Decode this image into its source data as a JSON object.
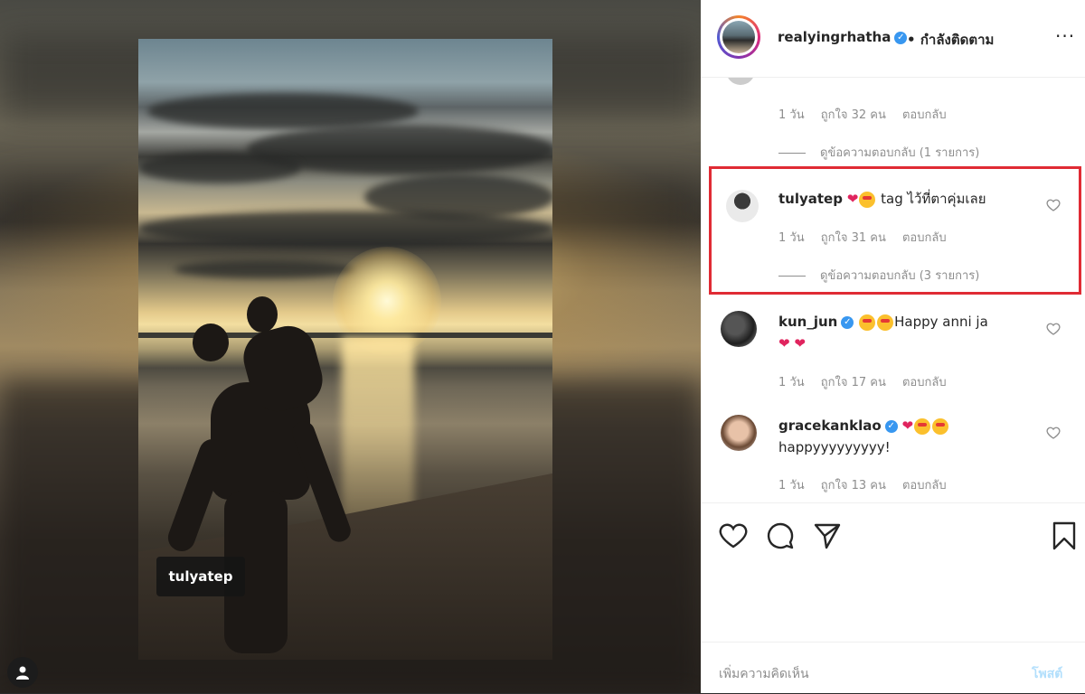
{
  "post": {
    "photo_tag": "tulyatep"
  },
  "header": {
    "username": "realyingrhatha",
    "separator": "•",
    "follow_status": "กำลังติดตาม",
    "more": "···"
  },
  "comments": {
    "top": {
      "partial_text": "",
      "time": "1 วัน",
      "likes": "ถูกใจ 32 คน",
      "reply": "ตอบกลับ",
      "view_replies": "ดูข้อความตอบกลับ (1 รายการ)"
    },
    "c1": {
      "username": "tulyatep",
      "text": "tag ไว้ที่ตาคุ่มเลย",
      "time": "1 วัน",
      "likes": "ถูกใจ 31 คน",
      "reply": "ตอบกลับ",
      "view_replies": "ดูข้อความตอบกลับ (3 รายการ)"
    },
    "c2": {
      "username": "kun_jun",
      "text": "Happy anni ja",
      "time": "1 วัน",
      "likes": "ถูกใจ 17 คน",
      "reply": "ตอบกลับ"
    },
    "c3": {
      "username": "gracekanklao",
      "text": "happyyyyyyyyy!",
      "time": "1 วัน",
      "likes": "ถูกใจ 13 คน",
      "reply": "ตอบกลับ"
    }
  },
  "composer": {
    "placeholder": "เพิ่มความคิดเห็น",
    "post_label": "โพสต์"
  },
  "colors": {
    "highlight_border": "#e02b34",
    "verified": "#3897f0",
    "heart": "#e0245e"
  }
}
